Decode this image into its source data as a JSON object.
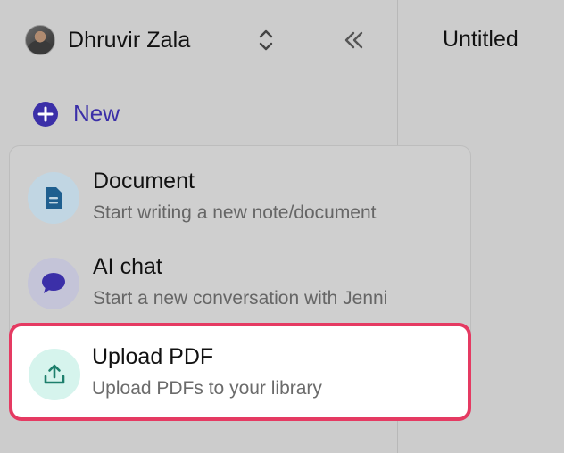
{
  "sidebar": {
    "user_name": "Dhruvir Zala",
    "new_label": "New"
  },
  "menu": {
    "items": [
      {
        "title": "Document",
        "description": "Start writing a new note/document",
        "icon": "document-icon"
      },
      {
        "title": "AI chat",
        "description": "Start a new conversation with Jenni",
        "icon": "chat-bubble-icon"
      },
      {
        "title": "Upload PDF",
        "description": "Upload PDFs to your library",
        "icon": "upload-icon"
      }
    ]
  },
  "main": {
    "title": "Untitled"
  },
  "colors": {
    "accent": "#3b2fa8",
    "highlight_border": "#e53a62",
    "document_icon": "#1f5f8f",
    "chat_icon": "#3b2fa8",
    "upload_icon": "#1d7f6c"
  }
}
